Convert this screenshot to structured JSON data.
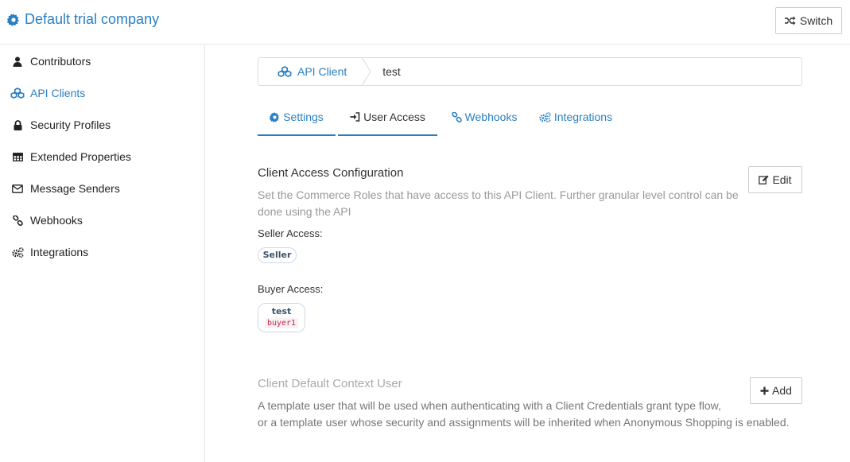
{
  "header": {
    "company": "Default trial company",
    "switch_label": "Switch"
  },
  "sidebar": {
    "items": [
      {
        "label": "Contributors",
        "icon": "user-icon"
      },
      {
        "label": "API Clients",
        "icon": "cubes-icon",
        "active": true
      },
      {
        "label": "Security Profiles",
        "icon": "lock-icon"
      },
      {
        "label": "Extended Properties",
        "icon": "table-icon"
      },
      {
        "label": "Message Senders",
        "icon": "envelope-icon"
      },
      {
        "label": "Webhooks",
        "icon": "link-icon"
      },
      {
        "label": "Integrations",
        "icon": "cogs-icon"
      }
    ]
  },
  "breadcrumb": {
    "parent": "API Client",
    "current": "test"
  },
  "tabs": [
    {
      "label": "Settings",
      "icon": "cog-icon"
    },
    {
      "label": "User Access",
      "icon": "sign-in-icon",
      "active": true
    },
    {
      "label": "Webhooks",
      "icon": "link-icon"
    },
    {
      "label": "Integrations",
      "icon": "cogs-icon"
    }
  ],
  "access": {
    "title": "Client Access Configuration",
    "description_line1": "Set the Commerce Roles that have access to this API Client. Further granular level control can be",
    "description_line2": "done using the API",
    "edit_label": "Edit",
    "seller_label": "Seller Access:",
    "seller_role": "Seller",
    "buyer_label": "Buyer Access:",
    "buyer_role": "test",
    "buyer_id": "buyer1"
  },
  "context_user": {
    "title": "Client Default Context User",
    "add_label": "Add",
    "description_line1": "A template user that will be used when authenticating with a Client Credentials grant type flow,",
    "description_line2": "or a template user whose security and assignments will be inherited when Anonymous Shopping is enabled."
  },
  "colors": {
    "accent": "#2a7fc1",
    "muted": "#999999",
    "code": "#c7254e"
  }
}
